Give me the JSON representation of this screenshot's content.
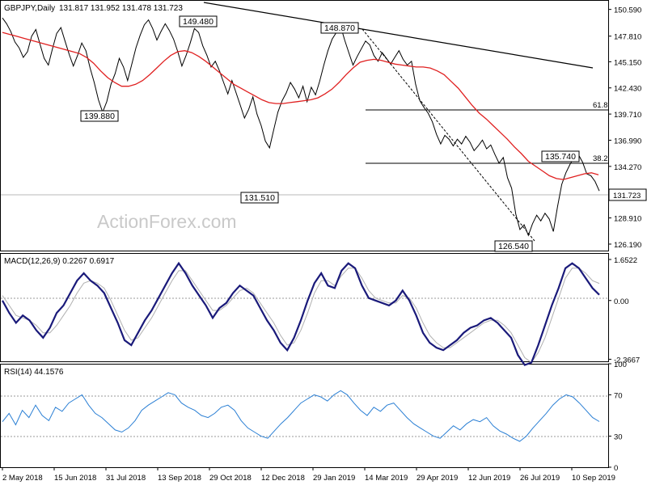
{
  "header": {
    "symbol": "GBPJPY,Daily",
    "ohlc": "131.817 131.952 131.478 131.723"
  },
  "watermark": "ActionForex.com",
  "colors": {
    "price": "#000000",
    "ma": "#e02020",
    "macd": "#1a1a7a",
    "signal": "#b0b0b0",
    "rsi": "#2a7fd4",
    "trendline": "#000000",
    "panel_border": "#000000",
    "gridline_dotted": "#9a9a9a"
  },
  "chart_data": [
    {
      "type": "line",
      "panel": "price",
      "title": "GBPJPY,Daily 131.817 131.952 131.478 131.723",
      "y_ticks": [
        "150.590",
        "147.810",
        "145.150",
        "142.430",
        "139.710",
        "136.990",
        "134.270",
        "131.723",
        "128.910",
        "126.190"
      ],
      "ylim": [
        125.6,
        151.4
      ],
      "x_ticks": [
        "2 May 2018",
        "15 Jun 2018",
        "31 Jul 2018",
        "13 Sep 2018",
        "29 Oct 2018",
        "12 Dec 2018",
        "29 Jan 2019",
        "14 Mar 2019",
        "29 Apr 2019",
        "12 Jun 2019",
        "26 Jul 2019",
        "10 Sep 2019"
      ],
      "series": [
        {
          "values": [
            149.7,
            149.1,
            148.3,
            147.2,
            146.6,
            145.6,
            146.2,
            147.8,
            148.5,
            147.0,
            145.5,
            144.8,
            146.5,
            148.1,
            148.7,
            147.3,
            145.9,
            144.7,
            145.8,
            147.1,
            146.3,
            144.5,
            143.0,
            141.2,
            139.9,
            141.0,
            142.8,
            143.9,
            145.5,
            144.6,
            143.2,
            144.9,
            146.6,
            147.9,
            149.0,
            149.5,
            148.6,
            147.4,
            148.3,
            149.1,
            148.4,
            147.5,
            146.2,
            144.7,
            145.8,
            147.1,
            148.6,
            148.2,
            146.8,
            145.8,
            144.6,
            145.2,
            144.2,
            143.0,
            141.8,
            143.2,
            141.9,
            140.6,
            139.3,
            140.2,
            141.5,
            139.7,
            138.5,
            136.9,
            136.2,
            138.1,
            139.9,
            141.1,
            141.9,
            143.0,
            142.3,
            141.4,
            142.6,
            141.0,
            142.5,
            141.7,
            143.1,
            144.8,
            146.3,
            147.5,
            148.2,
            148.9,
            147.4,
            146.1,
            144.8,
            145.7,
            146.5,
            147.3,
            146.9,
            145.8,
            145.2,
            146.1,
            145.5,
            144.9,
            145.6,
            146.3,
            145.4,
            144.8,
            145.2,
            142.8,
            141.1,
            140.4,
            139.8,
            138.9,
            137.6,
            136.6,
            137.5,
            137.1,
            136.4,
            137.1,
            136.6,
            137.4,
            136.8,
            135.9,
            136.4,
            137.0,
            136.1,
            136.5,
            135.5,
            134.6,
            135.2,
            133.1,
            132.0,
            129.3,
            127.7,
            128.2,
            127.1,
            128.3,
            129.2,
            128.6,
            129.4,
            128.8,
            127.5,
            130.1,
            132.4,
            133.6,
            134.5,
            135.2,
            135.5,
            134.7,
            133.5,
            133.3,
            132.7,
            131.72
          ]
        },
        {
          "values": [
            148.2,
            148.0,
            147.8,
            147.6,
            147.4,
            147.2,
            147.0,
            146.8,
            146.6,
            146.4,
            146.2,
            146.0,
            145.6,
            145.0,
            144.2,
            143.5,
            143.0,
            142.6,
            142.6,
            142.8,
            143.2,
            143.8,
            144.5,
            145.2,
            145.8,
            146.2,
            146.3,
            146.1,
            145.7,
            145.2,
            144.6,
            144.0,
            143.4,
            142.8,
            142.4,
            142.0,
            141.6,
            141.2,
            140.9,
            140.8,
            140.8,
            140.9,
            141.0,
            141.1,
            141.2,
            141.4,
            141.8,
            142.3,
            143.0,
            143.8,
            144.5,
            145.1,
            145.3,
            145.4,
            145.3,
            145.1,
            144.9,
            144.8,
            144.7,
            144.6,
            144.6,
            144.5,
            144.2,
            143.8,
            143.1,
            142.4,
            141.5,
            140.6,
            139.8,
            139.2,
            138.5,
            137.8,
            137.1,
            136.3,
            135.6,
            134.8,
            134.3,
            133.8,
            133.3,
            133.0,
            132.9,
            133.1,
            133.3,
            133.5,
            133.6,
            133.4
          ],
          "x_start": 100
        }
      ],
      "annotations": [
        {
          "text": "149.480",
          "value": 149.48
        },
        {
          "text": "139.880",
          "value": 139.88
        },
        {
          "text": "131.510",
          "value": 131.51
        },
        {
          "text": "148.870",
          "value": 148.87
        },
        {
          "text": "135.740",
          "value": 135.74
        },
        {
          "text": "126.540",
          "value": 126.54
        },
        {
          "text": "61.8",
          "value": 139.88
        },
        {
          "text": "38.2",
          "value": 135.74
        }
      ]
    },
    {
      "type": "line",
      "panel": "macd",
      "title": "MACD(12,26,9) 0.2267 0.6917",
      "y_ticks": [
        "1.6522",
        "0.00",
        "-2.3667"
      ],
      "ylim": [
        -2.45,
        1.75
      ],
      "series": [
        {
          "values": [
            0.0,
            -0.5,
            -0.9,
            -0.6,
            -0.8,
            -1.2,
            -1.5,
            -1.1,
            -0.5,
            -0.2,
            0.3,
            0.8,
            1.1,
            0.8,
            0.6,
            0.3,
            -0.3,
            -0.9,
            -1.6,
            -1.8,
            -1.3,
            -0.8,
            -0.4,
            0.1,
            0.6,
            1.1,
            1.5,
            1.1,
            0.6,
            0.2,
            -0.2,
            -0.7,
            -0.3,
            -0.1,
            0.3,
            0.6,
            0.4,
            0.2,
            -0.3,
            -0.8,
            -1.2,
            -1.7,
            -2.0,
            -1.5,
            -0.8,
            0.0,
            0.7,
            1.1,
            0.6,
            0.5,
            1.2,
            1.5,
            1.3,
            0.6,
            0.1,
            0.0,
            -0.1,
            -0.2,
            0.0,
            0.4,
            0.0,
            -0.6,
            -1.3,
            -1.7,
            -1.9,
            -2.0,
            -1.8,
            -1.6,
            -1.3,
            -1.1,
            -1.0,
            -0.8,
            -0.7,
            -0.9,
            -1.2,
            -1.5,
            -2.2,
            -2.6,
            -2.5,
            -1.8,
            -1.0,
            -0.2,
            0.5,
            1.3,
            1.5,
            1.3,
            0.9,
            0.5,
            0.23
          ]
        },
        {
          "values": [
            0.2,
            -0.2,
            -0.6,
            -0.7,
            -0.8,
            -1.0,
            -1.3,
            -1.3,
            -1.0,
            -0.6,
            -0.2,
            0.3,
            0.7,
            0.8,
            0.7,
            0.5,
            0.0,
            -0.6,
            -1.2,
            -1.6,
            -1.5,
            -1.1,
            -0.7,
            -0.2,
            0.3,
            0.8,
            1.2,
            1.2,
            0.8,
            0.4,
            0.0,
            -0.4,
            -0.4,
            -0.2,
            0.1,
            0.4,
            0.5,
            0.3,
            -0.1,
            -0.5,
            -0.9,
            -1.4,
            -1.8,
            -1.7,
            -1.2,
            -0.5,
            0.3,
            0.8,
            0.8,
            0.6,
            1.0,
            1.3,
            1.3,
            0.9,
            0.4,
            0.1,
            0.0,
            -0.1,
            -0.1,
            0.2,
            0.1,
            -0.3,
            -0.9,
            -1.4,
            -1.7,
            -1.9,
            -1.9,
            -1.7,
            -1.5,
            -1.3,
            -1.1,
            -0.9,
            -0.8,
            -0.8,
            -1.0,
            -1.3,
            -1.8,
            -2.3,
            -2.5,
            -2.1,
            -1.5,
            -0.7,
            0.1,
            0.9,
            1.3,
            1.3,
            1.1,
            0.8,
            0.69
          ]
        }
      ]
    },
    {
      "type": "line",
      "panel": "rsi",
      "title": "RSI(14) 44.1576",
      "y_ticks": [
        "100",
        "70",
        "30",
        "0"
      ],
      "ylim": [
        0,
        100
      ],
      "series": [
        {
          "values": [
            44,
            52,
            41,
            55,
            48,
            60,
            50,
            45,
            58,
            54,
            62,
            66,
            70,
            60,
            52,
            48,
            42,
            36,
            34,
            38,
            45,
            55,
            60,
            64,
            68,
            72,
            70,
            62,
            58,
            55,
            50,
            48,
            52,
            58,
            60,
            55,
            45,
            38,
            34,
            30,
            28,
            35,
            42,
            48,
            55,
            62,
            66,
            70,
            68,
            64,
            70,
            74,
            70,
            62,
            55,
            50,
            58,
            54,
            60,
            62,
            55,
            48,
            42,
            38,
            34,
            30,
            28,
            34,
            40,
            36,
            42,
            46,
            44,
            48,
            40,
            35,
            32,
            28,
            25,
            30,
            38,
            45,
            52,
            60,
            66,
            70,
            68,
            62,
            55,
            48,
            44.16
          ]
        }
      ]
    }
  ]
}
